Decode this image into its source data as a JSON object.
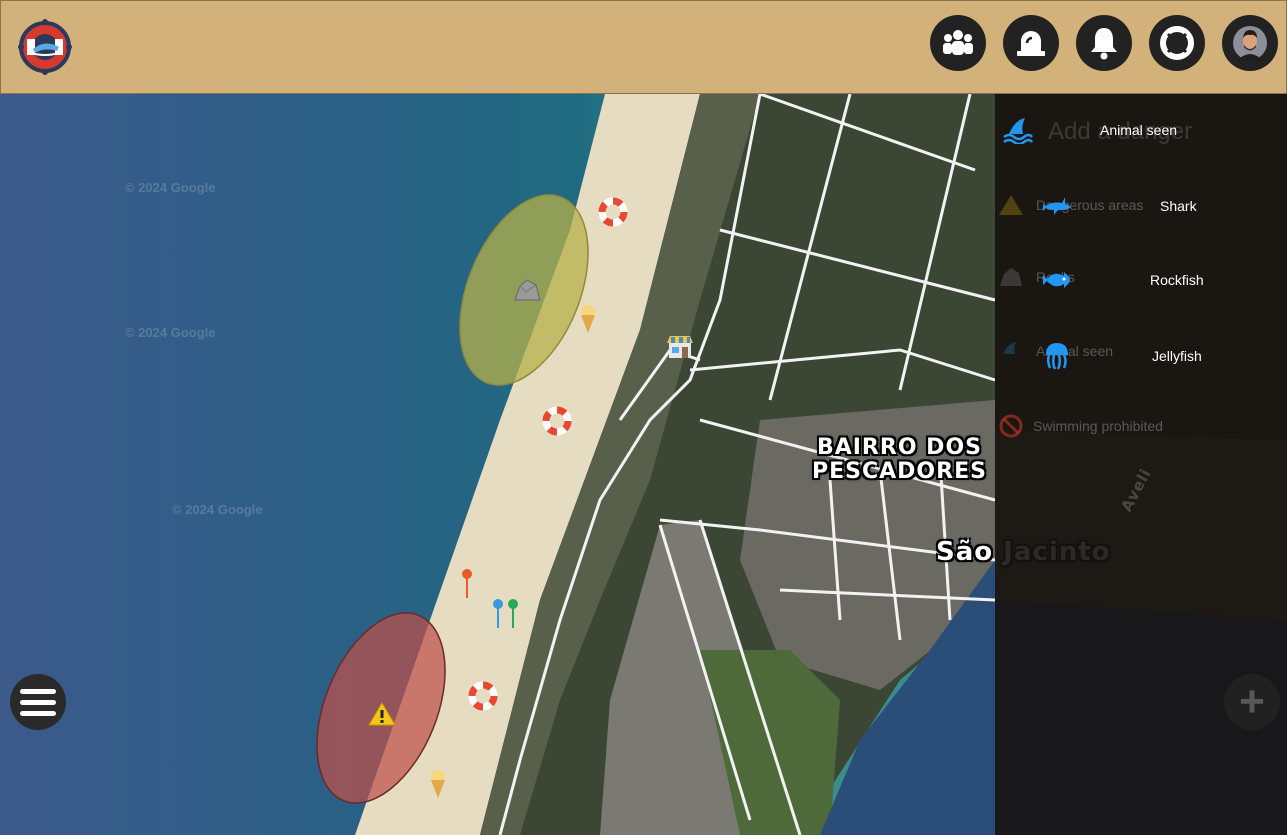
{
  "map": {
    "watermark": "© 2024 Google",
    "neighborhood_label": "BAIRRO DOS\nPESCADORES",
    "town_label": "São Jacinto",
    "street_label": "Aveli"
  },
  "panel": {
    "title": "Add a danger",
    "faded_items": [
      "Dangerous areas",
      "Rocks",
      "Animal seen",
      "Swimming prohibited"
    ],
    "animal_menu": {
      "header": "Animal seen",
      "options": [
        "Shark",
        "Rockfish",
        "Jellyfish"
      ]
    }
  },
  "colors": {
    "topbar": "#d2b27a",
    "icon_blue": "#2196f3",
    "danger_zone": "#c0504a",
    "warning_zone": "#b6b04a"
  },
  "toolbar": {
    "icons": [
      "group-icon",
      "siren-icon",
      "bell-icon",
      "lifebuoy-icon",
      "avatar"
    ]
  }
}
